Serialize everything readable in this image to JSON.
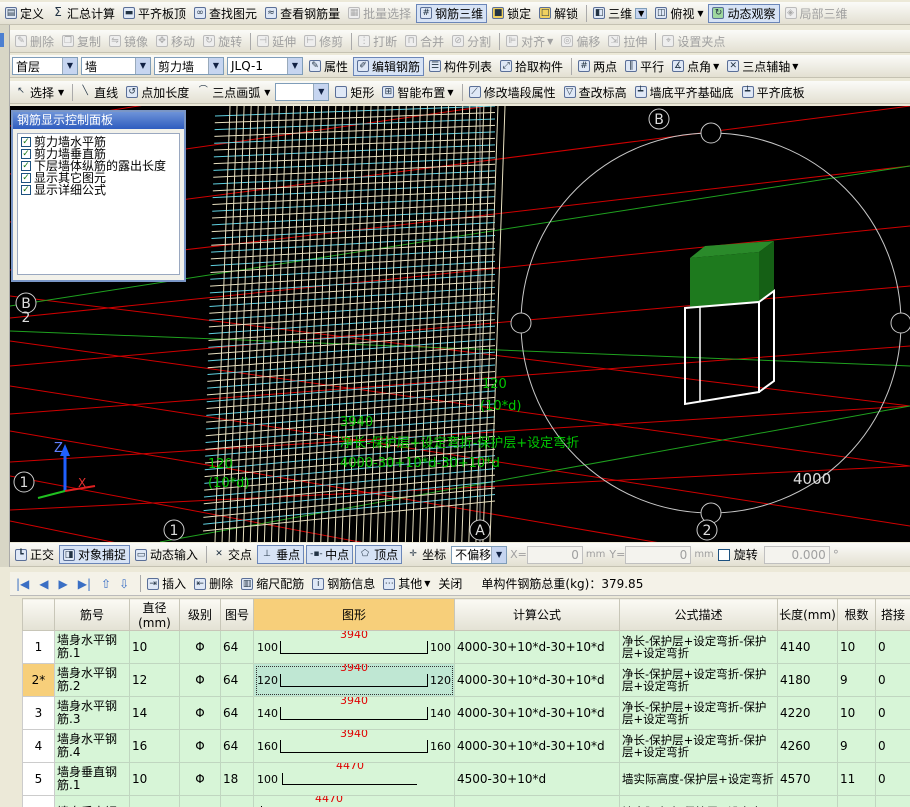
{
  "toolbar1": {
    "items": [
      "定义",
      "汇总计算",
      "平齐板顶",
      "查找图元",
      "查看钢筋量",
      "批量选择",
      "钢筋三维",
      "锁定",
      "解锁",
      "三维",
      "俯视",
      "动态观察",
      "局部三维"
    ]
  },
  "toolbar2": {
    "items": [
      "删除",
      "复制",
      "镜像",
      "移动",
      "旋转",
      "延伸",
      "修剪",
      "打断",
      "合并",
      "分割",
      "对齐",
      "偏移",
      "拉伸",
      "设置夹点"
    ]
  },
  "toolbar3": {
    "floor": "首层",
    "type": "墙",
    "subtype": "剪力墙",
    "element": "JLQ-1",
    "items": [
      "属性",
      "编辑钢筋",
      "构件列表",
      "拾取构件",
      "两点",
      "平行",
      "点角",
      "三点辅轴"
    ]
  },
  "toolbar4": {
    "items": [
      "选择",
      "直线",
      "点加长度",
      "三点画弧",
      "",
      "矩形",
      "智能布置",
      "修改墙段属性",
      "查改标高",
      "墙底平齐基础底",
      "平齐底板"
    ]
  },
  "panel": {
    "title": "钢筋显示控制面板",
    "options": [
      "剪力墙水平筋",
      "剪力墙垂直筋",
      "下层墙体纵筋的露出长度",
      "显示其它图元",
      "显示详细公式"
    ]
  },
  "canvas": {
    "axis_b_top": "B",
    "axis_b_left": "B",
    "axis_2_left": "2",
    "axis_1_left": "1",
    "axis_1_bottom": "1",
    "axis_a": "A",
    "axis_2_bottom": "2",
    "dim_4000": "4000",
    "ann_left_120": "120",
    "ann_left_10d": "(10*d)",
    "ann_right_120": "120",
    "ann_right_10d": "(10*d)",
    "ann_len": "3940",
    "ann_formula_desc": "净长-保护层+设定弯折-保护层+设定弯折",
    "ann_formula": "4000-30+10*d-30+10*d",
    "colors": {
      "grid": "#d00000",
      "green": "#1fa11f",
      "rebar": "#e8e0c0",
      "cyan": "#5fd0e0",
      "text_green": "#00c800"
    }
  },
  "snapbar": {
    "items": [
      "正交",
      "对象捕捉",
      "动态输入",
      "交点",
      "垂点",
      "中点",
      "顶点",
      "坐标"
    ],
    "offset_mode": "不偏移",
    "x_label": "X=",
    "x_val": "0",
    "y_label": "Y=",
    "y_val": "0",
    "unit": "mm",
    "rotate_label": "旋转",
    "rotate_val": "0.000"
  },
  "tablebar": {
    "items": [
      "插入",
      "删除",
      "缩尺配筋",
      "钢筋信息",
      "其他",
      "关闭"
    ],
    "total": "单构件钢筋总重(kg)：379.85"
  },
  "table": {
    "headers": [
      "",
      "筋号",
      "直径(mm)",
      "级别",
      "图号",
      "图形",
      "计算公式",
      "公式描述",
      "长度(mm)",
      "根数",
      "搭接"
    ],
    "rows": [
      {
        "no": "1",
        "name": "墙身水平钢筋.1",
        "dia": "10",
        "grade": "Φ",
        "fig": "64",
        "left": "100",
        "mid": "3940",
        "right": "100",
        "formula": "4000-30+10*d-30+10*d",
        "desc": "净长-保护层+设定弯折-保护层+设定弯折",
        "len": "4140",
        "count": "10",
        "lap": "0"
      },
      {
        "no": "2*",
        "name": "墙身水平钢筋.2",
        "dia": "12",
        "grade": "Φ",
        "fig": "64",
        "left": "120",
        "mid": "3940",
        "right": "120",
        "formula": "4000-30+10*d-30+10*d",
        "desc": "净长-保护层+设定弯折-保护层+设定弯折",
        "len": "4180",
        "count": "9",
        "lap": "0"
      },
      {
        "no": "3",
        "name": "墙身水平钢筋.3",
        "dia": "14",
        "grade": "Φ",
        "fig": "64",
        "left": "140",
        "mid": "3940",
        "right": "140",
        "formula": "4000-30+10*d-30+10*d",
        "desc": "净长-保护层+设定弯折-保护层+设定弯折",
        "len": "4220",
        "count": "10",
        "lap": "0"
      },
      {
        "no": "4",
        "name": "墙身水平钢筋.4",
        "dia": "16",
        "grade": "Φ",
        "fig": "64",
        "left": "160",
        "mid": "3940",
        "right": "160",
        "formula": "4000-30+10*d-30+10*d",
        "desc": "净长-保护层+设定弯折-保护层+设定弯折",
        "len": "4260",
        "count": "9",
        "lap": "0"
      },
      {
        "no": "5",
        "name": "墙身垂直钢筋.1",
        "dia": "10",
        "grade": "Φ",
        "fig": "18",
        "left": "100",
        "mid": "4470",
        "right": "",
        "formula": "4500-30+10*d",
        "desc": "墙实际高度-保护层+设定弯折",
        "len": "4570",
        "count": "11",
        "lap": "0"
      },
      {
        "no": "",
        "name": "墙身垂直钢",
        "dia": "",
        "grade": "",
        "fig": "",
        "left": "",
        "mid": "4470",
        "right": "",
        "formula": "",
        "desc": "墙实际高度-保护层+设定弯",
        "len": "",
        "count": "",
        "lap": ""
      }
    ]
  }
}
